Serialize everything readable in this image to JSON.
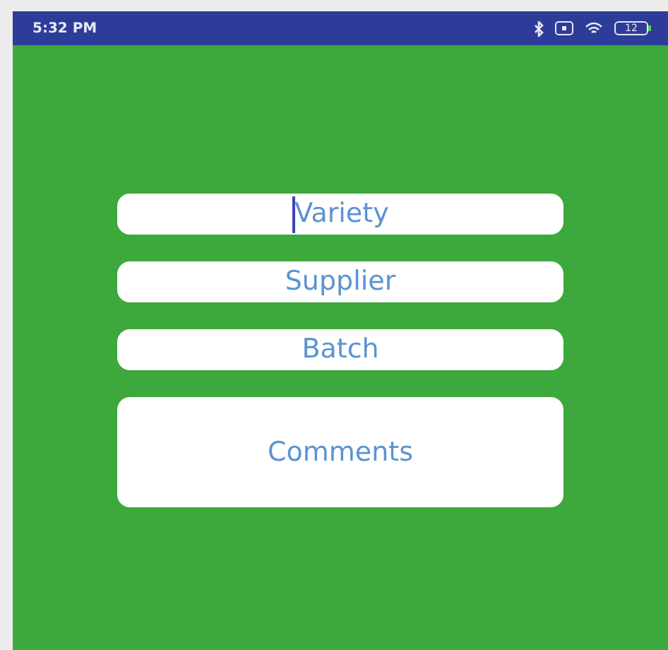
{
  "status_bar": {
    "time": "5:32 PM",
    "battery": "12"
  },
  "fields": [
    {
      "kind": "line",
      "placeholder": "Variety",
      "focused": true
    },
    {
      "kind": "line",
      "placeholder": "Supplier",
      "focused": false
    },
    {
      "kind": "line",
      "placeholder": "Batch",
      "focused": false
    },
    {
      "kind": "multiline",
      "placeholder": "Comments",
      "focused": false
    }
  ]
}
